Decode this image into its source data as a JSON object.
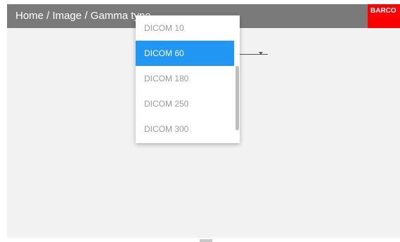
{
  "header": {
    "breadcrumb": "Home / Image / Gamma type",
    "logo_text": "BARCO"
  },
  "dropdown": {
    "options": [
      {
        "label": "DICOM 10"
      },
      {
        "label": "DICOM 60"
      },
      {
        "label": "DICOM 180"
      },
      {
        "label": "DICOM 250"
      },
      {
        "label": "DICOM 300"
      }
    ],
    "selected": "DICOM 60"
  },
  "colors": {
    "header_bg": "#7a7a7a",
    "logo_bg": "#ff0000",
    "selected_bg": "#2196f3",
    "panel_bg": "#f2f2f2"
  },
  "icons": {
    "select_arrow": "chevron-down-icon",
    "logo": "barco-logo"
  }
}
